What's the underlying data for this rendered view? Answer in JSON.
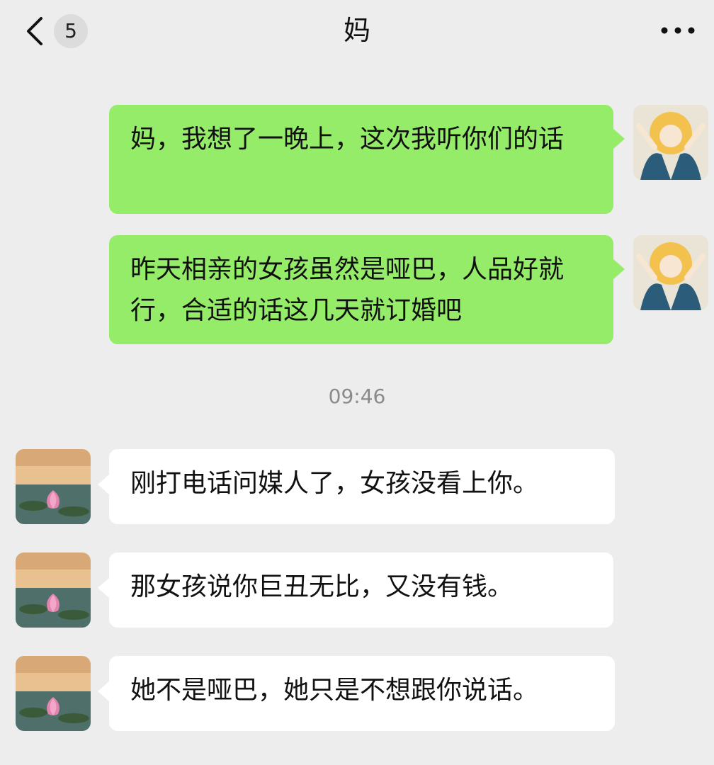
{
  "header": {
    "unread_count": "5",
    "title": "妈"
  },
  "messages": [
    {
      "direction": "outgoing",
      "text": "妈，我想了一晚上，这次我听你们的话"
    },
    {
      "direction": "outgoing",
      "text": "昨天相亲的女孩虽然是哑巴，人品好就行，合适的话这几天就订婚吧"
    },
    {
      "direction": "incoming",
      "text": "刚打电话问媒人了，女孩没看上你。"
    },
    {
      "direction": "incoming",
      "text": "那女孩说你巨丑无比，又没有钱。"
    },
    {
      "direction": "incoming",
      "text": "她不是哑巴，她只是不想跟你说话。"
    }
  ],
  "timestamp": "09:46",
  "colors": {
    "background": "#ededed",
    "outgoing_bubble": "#95ec69",
    "incoming_bubble": "#ffffff"
  },
  "icons": {
    "back": "chevron-left-icon",
    "more": "more-dots-icon"
  }
}
